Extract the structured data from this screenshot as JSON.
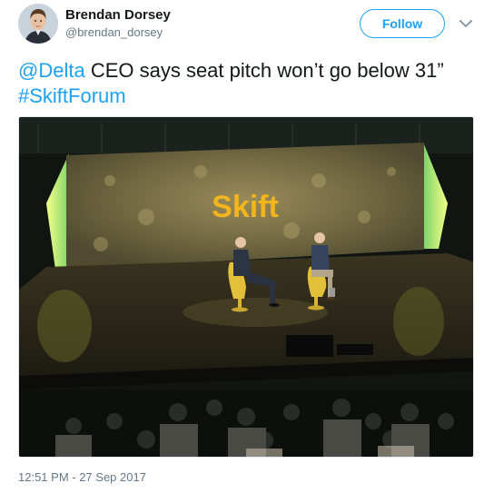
{
  "author": {
    "display_name": "Brendan Dorsey",
    "handle": "@brendan_dorsey"
  },
  "follow_button": {
    "label": "Follow"
  },
  "menu": {
    "icon": "chevron-down-icon"
  },
  "tweet": {
    "mention": "@Delta",
    "text_middle": " CEO says seat pitch won’t go below 31” ",
    "hashtag": "#SkiftForum"
  },
  "media": {
    "stage_logo_text": "Skift"
  },
  "timestamp": "12:51 PM - 27 Sep 2017",
  "colors": {
    "link": "#1da1f2",
    "name": "#14171a",
    "secondary": "#657786"
  }
}
